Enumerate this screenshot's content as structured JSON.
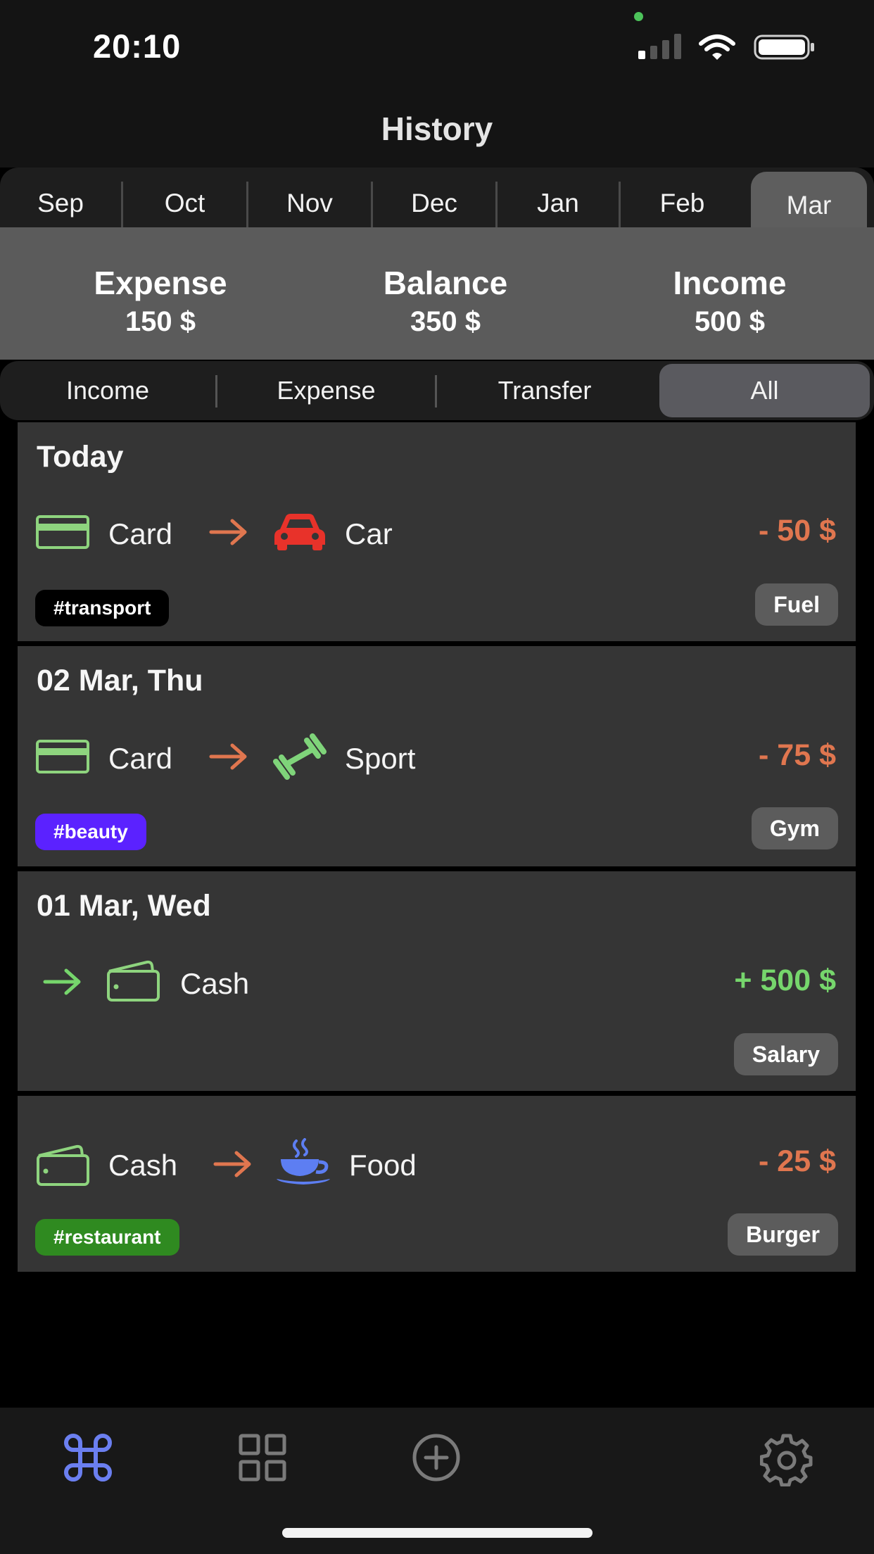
{
  "status": {
    "time": "20:10"
  },
  "header": {
    "title": "History"
  },
  "months": [
    {
      "label": "Sep"
    },
    {
      "label": "Oct"
    },
    {
      "label": "Nov"
    },
    {
      "label": "Dec"
    },
    {
      "label": "Jan"
    },
    {
      "label": "Feb"
    },
    {
      "label": "Mar",
      "active": true
    }
  ],
  "summary": {
    "expense_label": "Expense",
    "expense_value": "150 $",
    "balance_label": "Balance",
    "balance_value": "350 $",
    "income_label": "Income",
    "income_value": "500 $"
  },
  "filters": [
    {
      "label": "Income"
    },
    {
      "label": "Expense"
    },
    {
      "label": "Transfer"
    },
    {
      "label": "All",
      "active": true
    }
  ],
  "transactions": [
    {
      "date": "Today",
      "from": "Card",
      "from_icon": "credit-card-icon",
      "to": "Car",
      "to_icon": "car-icon",
      "amount": "- 50 $",
      "tag": "#transport",
      "tag_color": "#000000",
      "category": "Fuel"
    },
    {
      "date": "02 Mar, Thu",
      "from": "Card",
      "from_icon": "credit-card-icon",
      "to": "Sport",
      "to_icon": "dumbbell-icon",
      "amount": "- 75 $",
      "tag": "#beauty",
      "tag_color": "#5b22ff",
      "category": "Gym"
    },
    {
      "date": "01 Mar, Wed",
      "to": "Cash",
      "to_icon": "wallet-icon",
      "amount": "+ 500 $",
      "category": "Salary"
    },
    {
      "from": "Cash",
      "from_icon": "wallet-icon",
      "to": "Food",
      "to_icon": "coffee-cup-icon",
      "amount": "- 25 $",
      "tag": "#restaurant",
      "tag_color": "#2f8a20",
      "category": "Burger"
    }
  ],
  "colors": {
    "expense": "#e0764f",
    "income": "#76d66c",
    "active_tab": "#6b7ff0"
  },
  "tabbar": [
    {
      "icon": "command-icon",
      "active": true
    },
    {
      "icon": "grid-icon"
    },
    {
      "icon": "add-circle-icon"
    },
    {
      "icon": "gear-icon"
    }
  ]
}
